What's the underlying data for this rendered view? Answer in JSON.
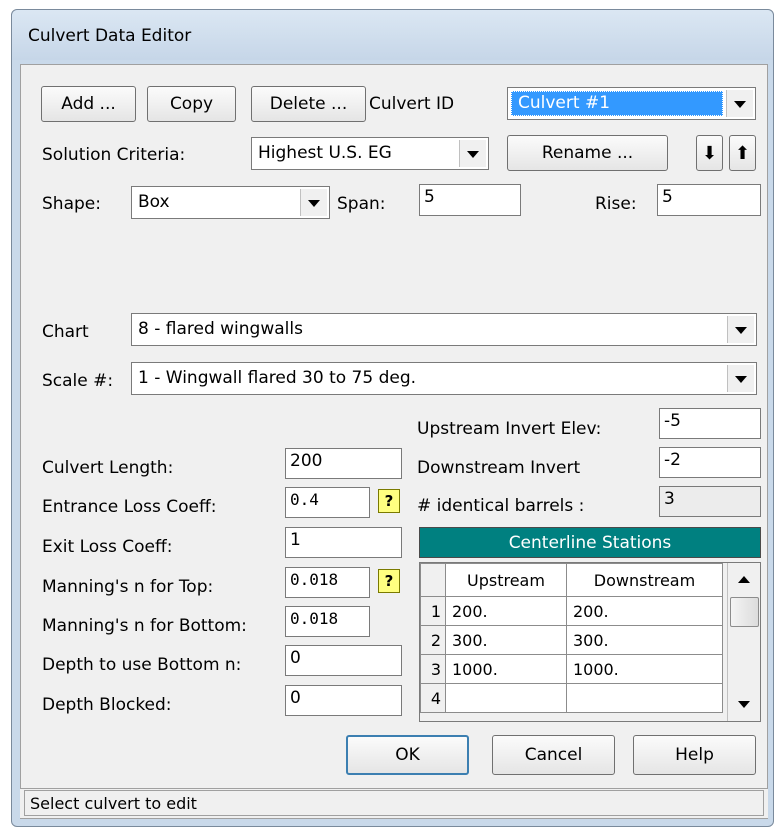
{
  "window": {
    "title": "Culvert Data Editor"
  },
  "toolbar": {
    "add_label": "Add ...",
    "copy_label": "Copy",
    "delete_label": "Delete ...",
    "rename_label": "Rename ...",
    "down_arrow": "⬇",
    "up_arrow": "⬆"
  },
  "culvert_id": {
    "label": "Culvert ID",
    "value": "Culvert #1"
  },
  "solution_criteria": {
    "label": "Solution Criteria:",
    "value": "Highest U.S. EG"
  },
  "shape": {
    "label": "Shape:",
    "value": "Box"
  },
  "span": {
    "label": "Span:",
    "value": "5"
  },
  "rise": {
    "label": "Rise:",
    "value": "5"
  },
  "chart": {
    "label": "Chart",
    "value": "8 - flared wingwalls"
  },
  "scale": {
    "label": "Scale #:",
    "value": "1 - Wingwall flared 30 to 75 deg."
  },
  "fields": {
    "upstream_invert": {
      "label": "Upstream Invert Elev:",
      "value": "-5"
    },
    "culvert_length": {
      "label": "Culvert Length:",
      "value": "200"
    },
    "downstream_invert": {
      "label": "Downstream Invert",
      "value": "-2"
    },
    "entrance_loss": {
      "label": "Entrance Loss Coeff:",
      "value": "0.4"
    },
    "identical_barrels": {
      "label": "# identical barrels :",
      "value": "3"
    },
    "exit_loss": {
      "label": "Exit Loss Coeff:",
      "value": "1"
    },
    "mannings_top": {
      "label": "Manning's n for Top:",
      "value": "0.018"
    },
    "mannings_bottom": {
      "label": "Manning's n for Bottom:",
      "value": "0.018"
    },
    "depth_bottom_n": {
      "label": "Depth to use Bottom n:",
      "value": "0"
    },
    "depth_blocked": {
      "label": "Depth Blocked:",
      "value": "0"
    }
  },
  "help_icon_glyph": "?",
  "centerline": {
    "title": "Centerline Stations",
    "columns": [
      "Upstream",
      "Downstream"
    ],
    "rows": [
      {
        "n": "1",
        "up": "200.",
        "down": "200."
      },
      {
        "n": "2",
        "up": "300.",
        "down": "300."
      },
      {
        "n": "3",
        "up": "1000.",
        "down": "1000."
      },
      {
        "n": "4",
        "up": "",
        "down": ""
      }
    ]
  },
  "buttons": {
    "ok": "OK",
    "cancel": "Cancel",
    "help": "Help"
  },
  "status": "Select culvert to edit",
  "colors": {
    "selection": "#3399ff",
    "teal_header": "#008080",
    "help_icon": "#ffff80"
  }
}
